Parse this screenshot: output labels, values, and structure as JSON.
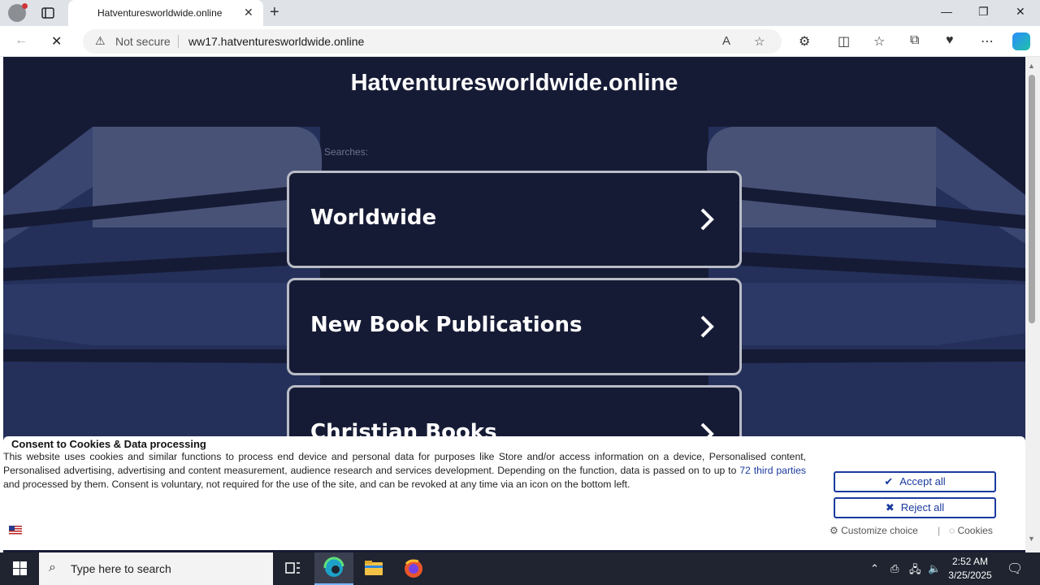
{
  "browser": {
    "tab_title": "Hatventuresworldwide.online",
    "security_label": "Not secure",
    "url": "ww17.hatventuresworldwide.online"
  },
  "page": {
    "site_title": "Hatventuresworldwide.online",
    "searches_label": "Searches:",
    "cards": [
      {
        "label": "Worldwide"
      },
      {
        "label": "New Book Publications"
      },
      {
        "label": "Christian Books"
      }
    ]
  },
  "consent": {
    "title": "Consent to Cookies & Data processing",
    "text_before": "This website uses cookies and similar functions to process end device and personal data for purposes like Store and/or access information on a device, Personalised content, Personalised advertising, advertising and content measurement, audience research and services development. Depending on the function, data is passed on to up to ",
    "link": "72 third parties",
    "text_after": " and processed by them. Consent is voluntary, not required for the use of the site, and can be revoked at any time via an icon on the bottom left.",
    "accept_label": "Accept all",
    "reject_label": "Reject all",
    "customize_label": "Customize choice",
    "cookies_label": "Cookies"
  },
  "taskbar": {
    "search_placeholder": "Type here to search",
    "time": "2:52 AM",
    "date": "3/25/2025"
  },
  "colors": {
    "page_bg": "#161b35",
    "accent": "#1a3a9e"
  }
}
